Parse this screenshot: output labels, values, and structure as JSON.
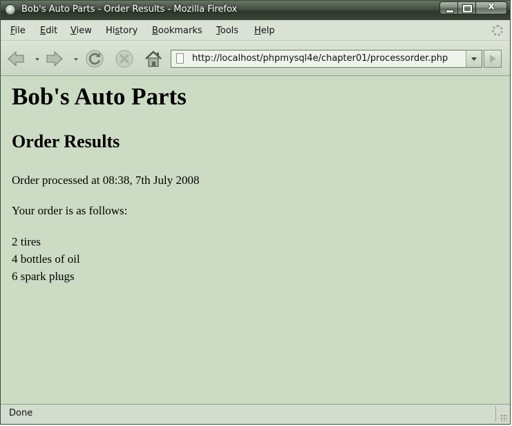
{
  "window": {
    "title": "Bob's Auto Parts - Order Results - Mozilla Firefox",
    "close_glyph": "x"
  },
  "menu": {
    "items": [
      {
        "acc": "F",
        "rest": "ile"
      },
      {
        "acc": "E",
        "rest": "dit"
      },
      {
        "acc": "V",
        "rest": "iew"
      },
      {
        "pre": "Hi",
        "acc": "s",
        "rest": "tory"
      },
      {
        "acc": "B",
        "rest": "ookmarks"
      },
      {
        "acc": "T",
        "rest": "ools"
      },
      {
        "acc": "H",
        "rest": "elp"
      }
    ]
  },
  "navbar": {
    "url": "http://localhost/phpmysql4e/chapter01/processorder.php"
  },
  "page": {
    "heading": "Bob's Auto Parts",
    "subheading": "Order Results",
    "processed": "Order processed at 08:38, 7th July 2008",
    "intro": "Your order is as follows:",
    "order_lines": [
      "2 tires",
      "4 bottles of oil",
      "6 spark plugs"
    ]
  },
  "status": {
    "text": "Done"
  },
  "colors": {
    "content_bg": "#ccdcc4",
    "chrome_bg": "#d9e2d4",
    "titlebar": "#2e372d"
  },
  "icons": [
    "firefox-icon",
    "back-icon",
    "forward-icon",
    "reload-icon",
    "stop-icon",
    "home-icon",
    "page-icon",
    "go-icon",
    "throbber-icon"
  ]
}
